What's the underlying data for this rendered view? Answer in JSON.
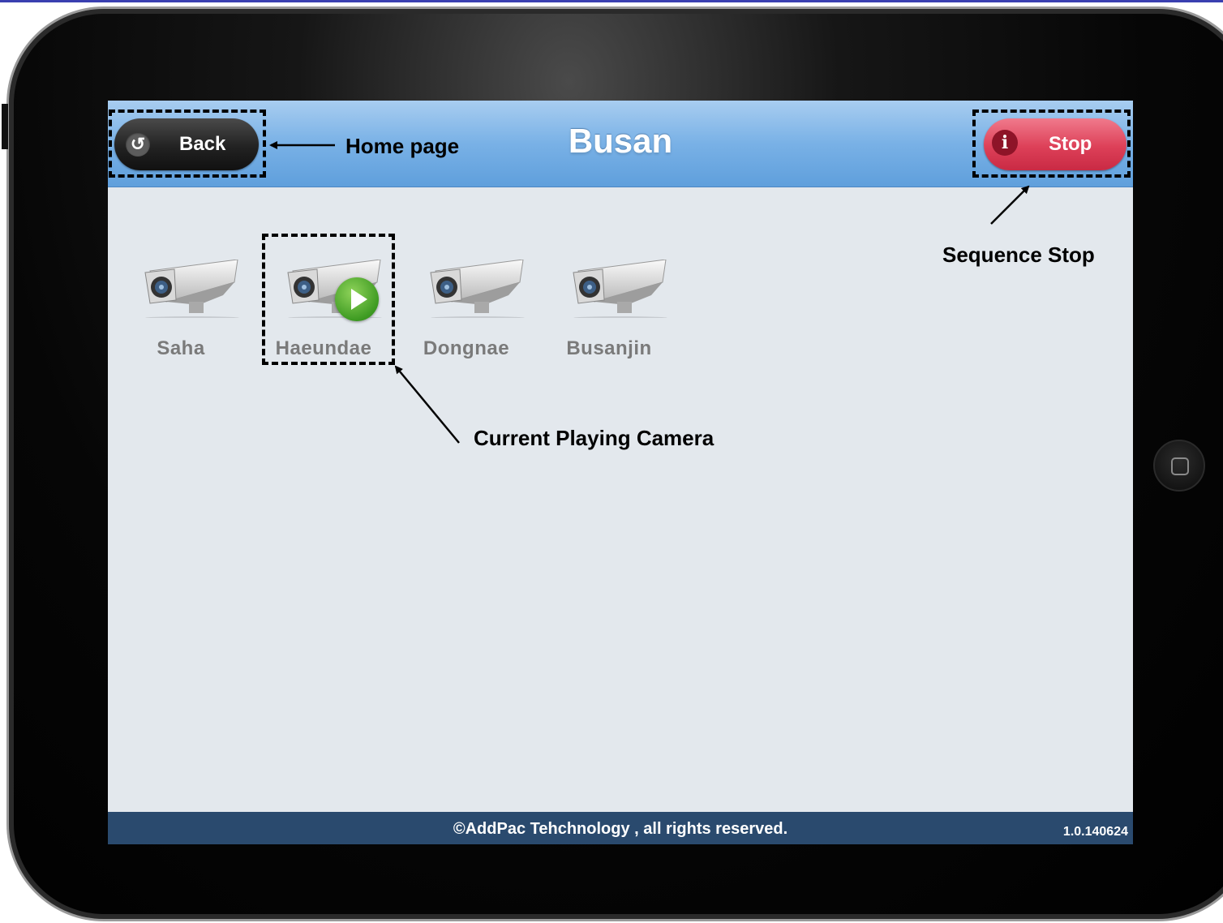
{
  "header": {
    "title": "Busan",
    "back_label": "Back",
    "back_icon": "undo-arrow-icon",
    "stop_label": "Stop",
    "stop_icon": "info-icon"
  },
  "cameras": [
    {
      "label": "Saha",
      "playing": false
    },
    {
      "label": "Haeundae",
      "playing": true
    },
    {
      "label": "Dongnae",
      "playing": false
    },
    {
      "label": "Busanjin",
      "playing": false
    }
  ],
  "footer": {
    "copyright": "©AddPac Tehchnology , all rights reserved.",
    "version": "1.0.140624"
  },
  "annotations": {
    "home_page": "Home page",
    "sequence_stop": "Sequence Stop",
    "current_camera": "Current Playing Camera"
  },
  "colors": {
    "header_blue": "#79b1e6",
    "stop_red": "#dd4058",
    "footer_navy": "#2a4a6e",
    "play_green": "#3e9b22"
  }
}
